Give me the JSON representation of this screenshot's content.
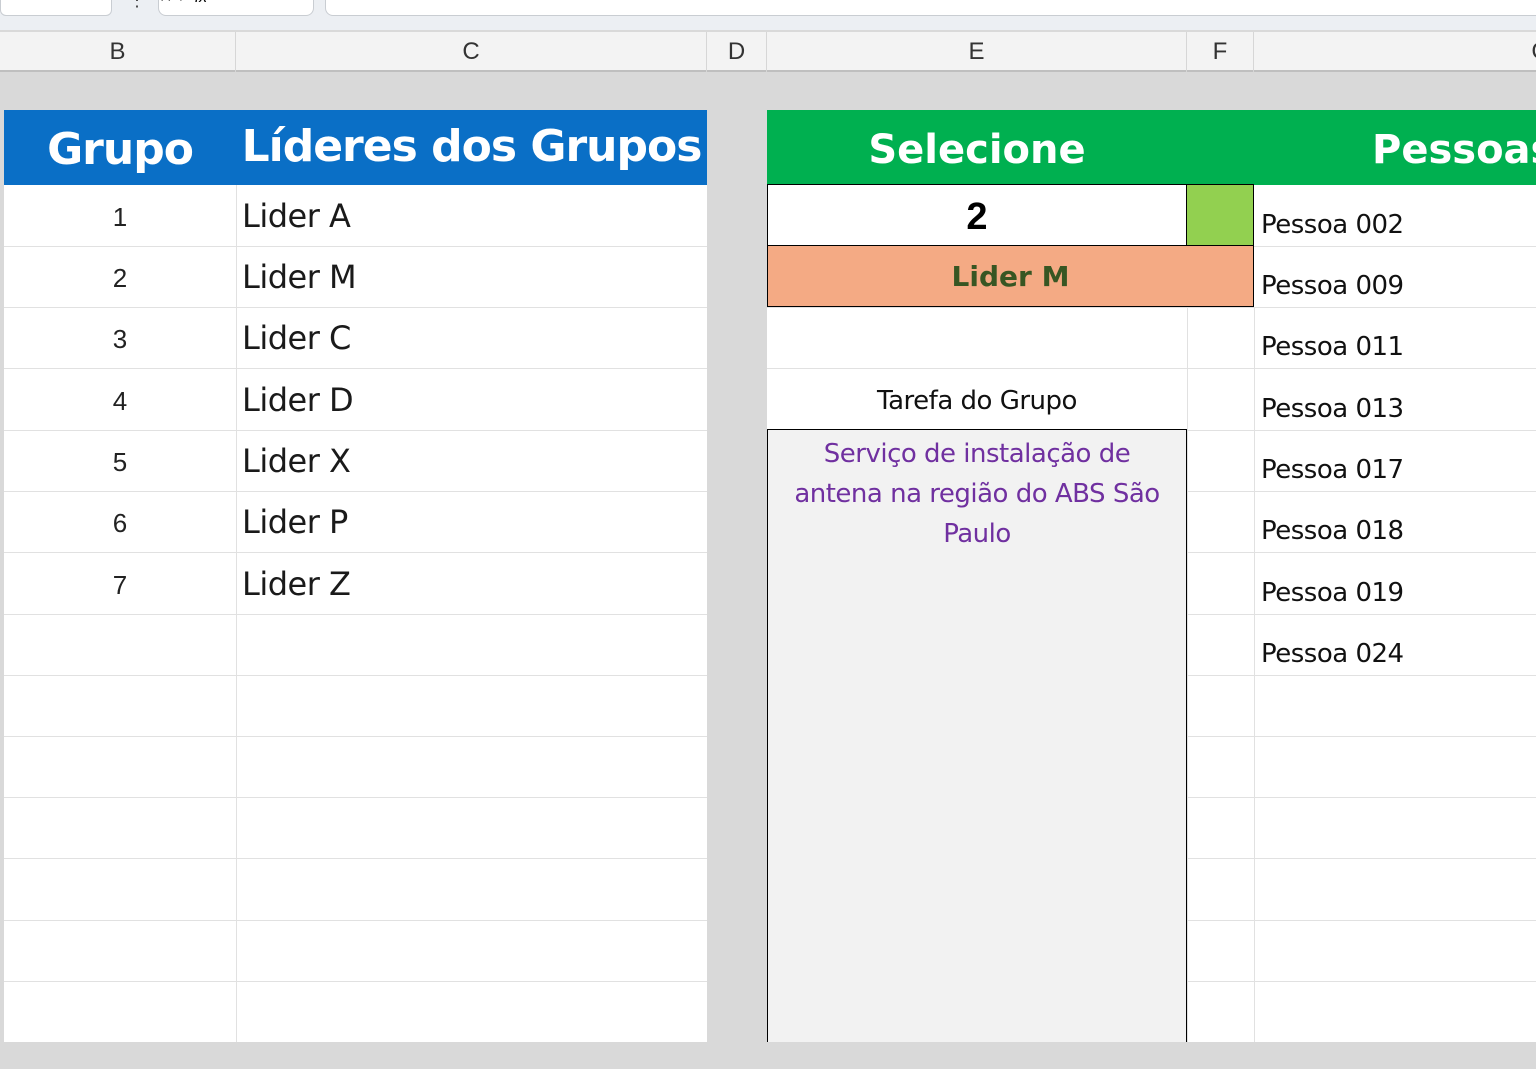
{
  "formula_bar": {
    "namebox_value": "",
    "fx_label": "fx",
    "formula_value": ""
  },
  "columns": [
    "B",
    "C",
    "D",
    "E",
    "F",
    "G"
  ],
  "left_table": {
    "header_group": "Grupo",
    "header_leaders": "Líderes dos Grupos",
    "rows": [
      {
        "group": "1",
        "leader": "Lider A"
      },
      {
        "group": "2",
        "leader": "Lider M"
      },
      {
        "group": "3",
        "leader": "Lider C"
      },
      {
        "group": "4",
        "leader": "Lider D"
      },
      {
        "group": "5",
        "leader": "Lider X"
      },
      {
        "group": "6",
        "leader": "Lider P"
      },
      {
        "group": "7",
        "leader": "Lider Z"
      }
    ]
  },
  "selector": {
    "header": "Selecione",
    "selected_value": "2",
    "leader_result": "Lider M",
    "task_label": "Tarefa do Grupo",
    "task_text": "Serviço de instalação de antena na região do ABS São Paulo"
  },
  "people": {
    "header": "Pessoas",
    "items": [
      "Pessoa 002",
      "Pessoa 009",
      "Pessoa 011",
      "Pessoa 013",
      "Pessoa 017",
      "Pessoa 018",
      "Pessoa 019",
      "Pessoa 024"
    ]
  },
  "colors": {
    "blue_header": "#0a6fc6",
    "green_header": "#00b050",
    "indicator": "#92d050",
    "leader_fill": "#f4aa84",
    "leader_text": "#375623",
    "task_text": "#7030a0"
  }
}
